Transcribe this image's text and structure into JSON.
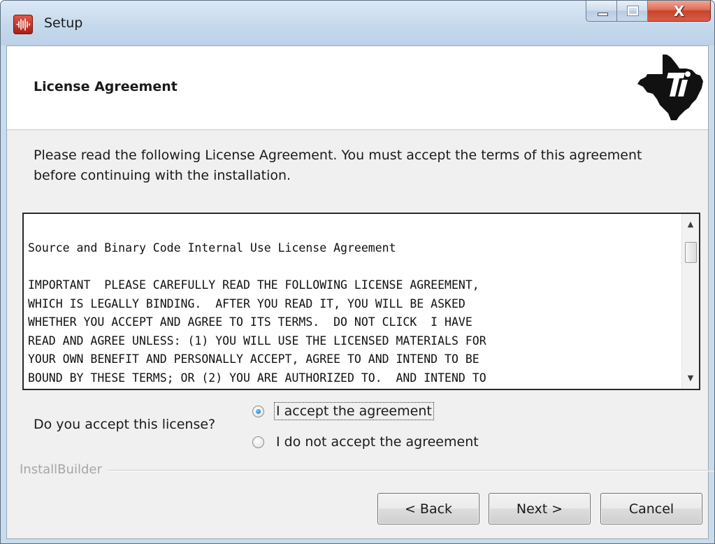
{
  "window": {
    "title": "Setup",
    "close_glyph": "X"
  },
  "header": {
    "title": "License Agreement",
    "logo_icon": "texas-instruments-logo"
  },
  "intro_text": "Please read the following License Agreement. You must accept the terms of this agreement before continuing with the installation.",
  "license": {
    "heading": "Source and Binary Code Internal Use License Agreement",
    "lines": [
      "IMPORTANT  PLEASE CAREFULLY READ THE FOLLOWING LICENSE AGREEMENT,",
      "WHICH IS LEGALLY BINDING.  AFTER YOU READ IT, YOU WILL BE ASKED",
      "WHETHER YOU ACCEPT AND AGREE TO ITS TERMS.  DO NOT CLICK  I HAVE",
      "READ AND AGREE UNLESS: (1) YOU WILL USE THE LICENSED MATERIALS FOR",
      "YOUR OWN BENEFIT AND PERSONALLY ACCEPT, AGREE TO AND INTEND TO BE",
      "BOUND BY THESE TERMS; OR (2) YOU ARE AUTHORIZED TO.  AND INTEND TO"
    ]
  },
  "acceptance": {
    "question": "Do you accept this license?",
    "options": [
      {
        "label": "I accept the agreement",
        "selected": true
      },
      {
        "label": "I do not accept the agreement",
        "selected": false
      }
    ]
  },
  "footer": {
    "brand": "InstallBuilder",
    "back_label": "< Back",
    "next_label": "Next >",
    "cancel_label": "Cancel"
  },
  "colors": {
    "titlebar": "#c6d9ec",
    "close_button": "#c8432c",
    "dialog_bg": "#f0f0f0",
    "ti_logo": "#111111"
  }
}
